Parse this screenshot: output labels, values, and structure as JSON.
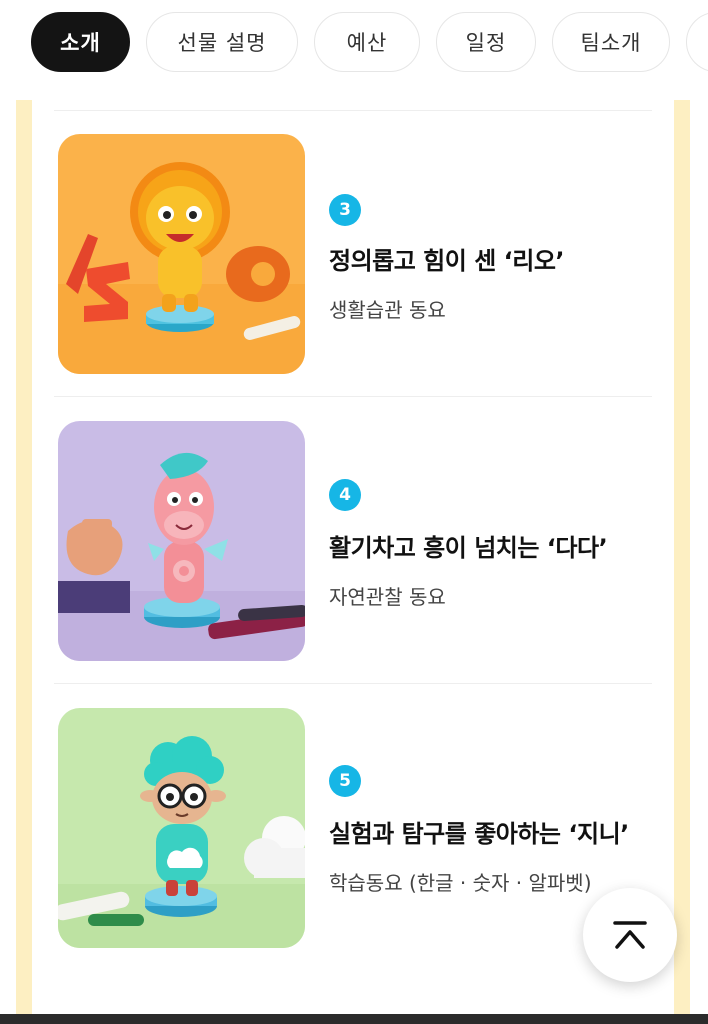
{
  "tabs": [
    {
      "label": "소개",
      "active": true
    },
    {
      "label": "선물 설명",
      "active": false
    },
    {
      "label": "예산",
      "active": false
    },
    {
      "label": "일정",
      "active": false
    },
    {
      "label": "팀소개",
      "active": false
    }
  ],
  "characters": [
    {
      "number": "3",
      "title": "정의롭고 힘이 센 ‘리오’",
      "subtitle": "생활습관 동요",
      "image_icon": "lion-figure"
    },
    {
      "number": "4",
      "title": "활기차고 흥이 넘치는 ‘다다’",
      "subtitle": "자연관찰 동요",
      "image_icon": "pink-horse-figure"
    },
    {
      "number": "5",
      "title": "실험과 탐구를 좋아하는 ‘지니’",
      "subtitle": "학습동요 (한글 · 숫자 · 알파벳)",
      "image_icon": "sheep-figure"
    }
  ],
  "colors": {
    "accent_badge": "#16b6e6",
    "active_tab": "#141414",
    "rail": "#fdefc2"
  },
  "scroll_top_icon": "scroll-to-top-icon"
}
